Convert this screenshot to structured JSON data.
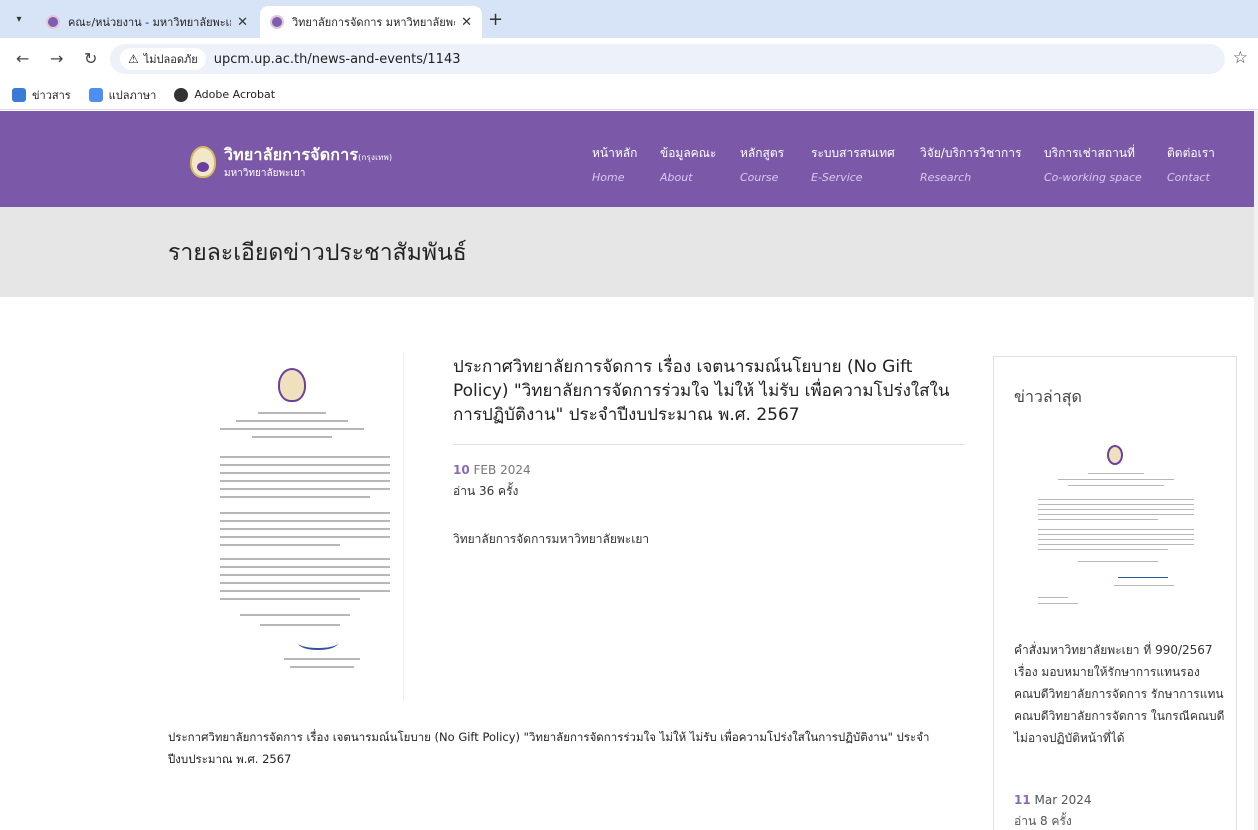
{
  "browser": {
    "tabs": [
      {
        "title": "คณะ/หน่วยงาน - มหาวิทยาลัยพะเยา"
      },
      {
        "title": "วิทยาลัยการจัดการ มหาวิทยาลัยพะเยา"
      }
    ],
    "new_tab": "+",
    "url": "upcm.up.ac.th/news-and-events/1143",
    "security_label": "ไม่ปลอดภัย",
    "bookmarks": [
      {
        "label": "ข่าวสาร",
        "icon": "news-icon"
      },
      {
        "label": "แปลภาษา",
        "icon": "translate-icon"
      },
      {
        "label": "Adobe Acrobat",
        "icon": "acrobat-icon"
      }
    ]
  },
  "site": {
    "logo_main": "วิทยาลัยการจัดการ",
    "logo_tag": "(กรุงเทพ)",
    "logo_sub": "มหาวิทยาลัยพะเยา",
    "brand_color": "#7b59a8",
    "nav": [
      {
        "th": "หน้าหลัก",
        "en": "Home"
      },
      {
        "th": "ข้อมูลคณะ",
        "en": "About"
      },
      {
        "th": "หลักสูตร",
        "en": "Course"
      },
      {
        "th": "ระบบสารสนเทศ",
        "en": "E-Service"
      },
      {
        "th": "วิจัย/บริการวิชาการ",
        "en": "Research"
      },
      {
        "th": "บริการเช่าสถานที่",
        "en": "Co-working space"
      },
      {
        "th": "ติดต่อเรา",
        "en": "Contact"
      }
    ]
  },
  "page": {
    "heading": "รายละเอียดข่าวประชาสัมพันธ์"
  },
  "article": {
    "title": "ประกาศวิทยาลัยการจัดการ เรื่อง เจตนารมณ์นโยบาย (No Gift Policy) \"วิทยาลัยการจัดการร่วมใจ ไม่ให้ ไม่รับ เพื่อความโปร่งใสใน การปฏิบัติงาน\" ประจำปีงบประมาณ พ.ศ. 2567",
    "date_day": "10",
    "date_rest": "FEB 2024",
    "reads": "อ่าน 36 ครั้ง",
    "author": "วิทยาลัยการจัดการมหาวิทยาลัยพะเยา",
    "body": "ประกาศวิทยาลัยการจัดการ เรื่อง เจตนารมณ์นโยบาย (No Gift Policy) \"วิทยาลัยการจัดการร่วมใจ ไม่ให้ ไม่รับ เพื่อความโปร่งใสในการปฏิบัติงาน\" ประจำปีงบประมาณ พ.ศ. 2567"
  },
  "sidebar": {
    "heading": "ข่าวล่าสุด",
    "item": {
      "title": "คำสั่งมหาวิทยาลัยพะเยา ที่ 990/2567 เรื่อง มอบหมายให้รักษาการแทนรองคณบดีวิทยาลัยการจัดการ รักษาการแทนคณบดีวิทยาลัยการจัดการ ในกรณีคณบดีไม่อาจปฏิบัติหน้าที่ได้",
      "date_day": "11",
      "date_rest": "Mar 2024",
      "reads": "อ่าน 8 ครั้ง"
    }
  }
}
